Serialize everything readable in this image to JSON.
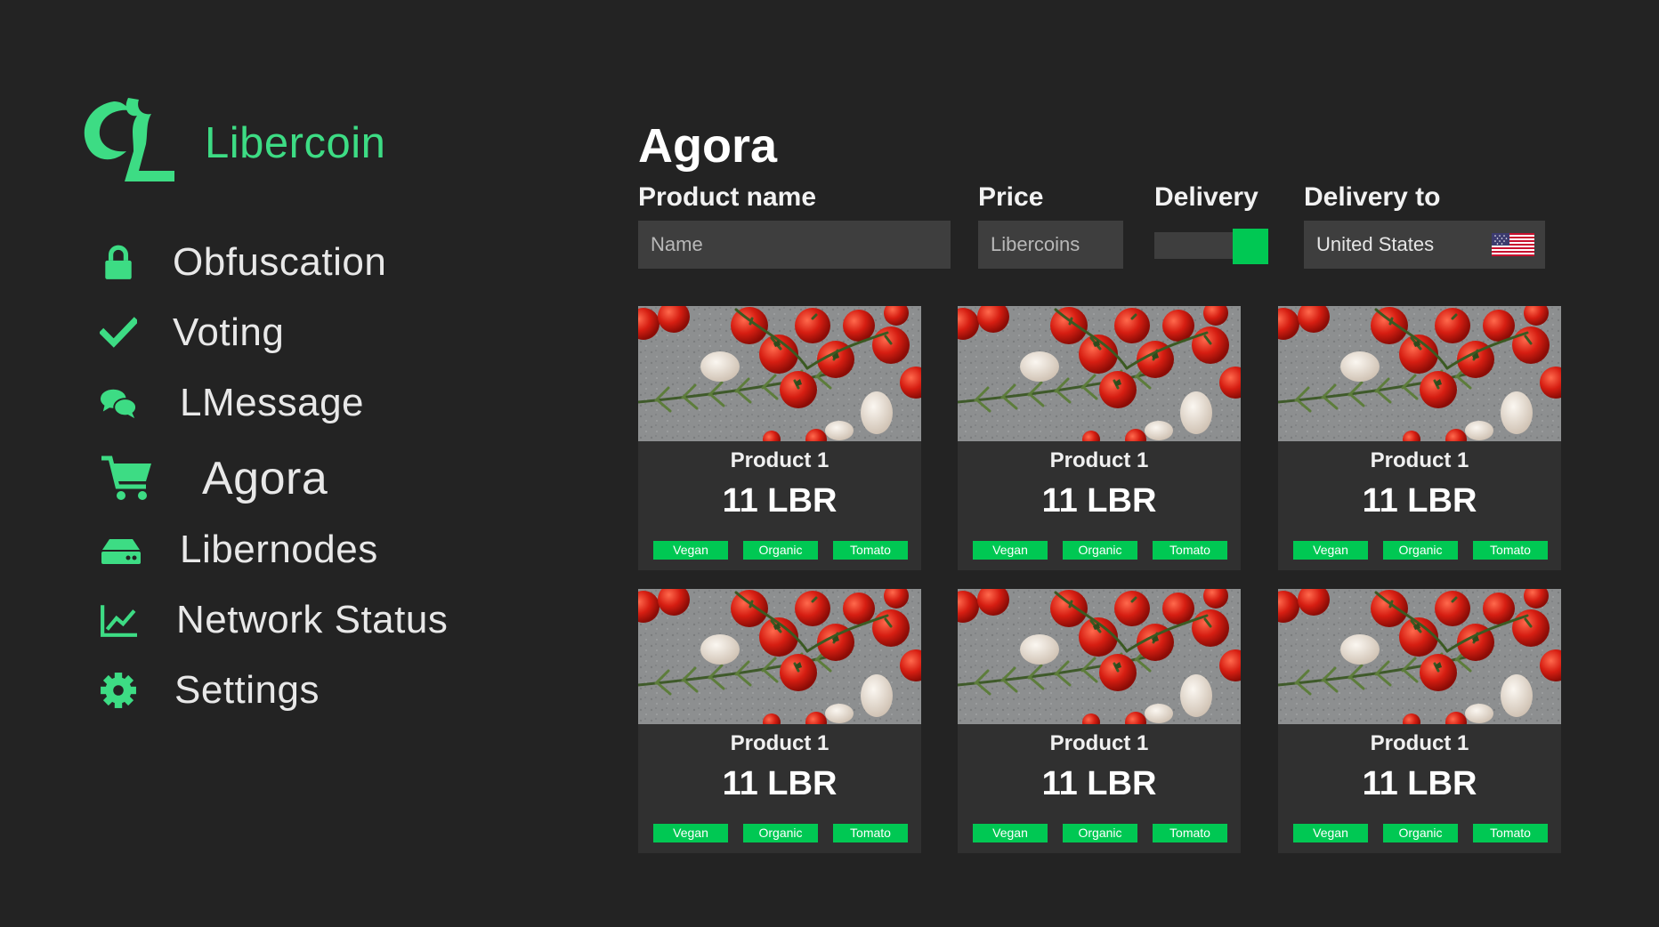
{
  "app": {
    "name": "Libercoin",
    "brand_color": "#3ddc84",
    "accent_color": "#00c853",
    "background": "#232323"
  },
  "sidebar": {
    "items": [
      {
        "label": "Obfuscation",
        "icon": "lock-icon"
      },
      {
        "label": "Voting",
        "icon": "checkmark-icon"
      },
      {
        "label": "LMessage",
        "icon": "chat-bubbles-icon"
      },
      {
        "label": "Agora",
        "icon": "shopping-cart-icon",
        "active": true
      },
      {
        "label": "Libernodes",
        "icon": "server-drive-icon"
      },
      {
        "label": "Network Status",
        "icon": "line-chart-icon"
      },
      {
        "label": "Settings",
        "icon": "gear-icon"
      }
    ]
  },
  "page": {
    "title": "Agora"
  },
  "filters": {
    "product_name": {
      "label": "Product name",
      "placeholder": "Name"
    },
    "price": {
      "label": "Price",
      "placeholder": "Libercoins"
    },
    "delivery": {
      "label": "Delivery",
      "enabled": true
    },
    "delivery_to": {
      "label": "Delivery to",
      "value": "United States",
      "flag": "us-flag-icon"
    }
  },
  "products": [
    {
      "name": "Product 1",
      "price": "11 LBR",
      "tags": [
        "Vegan",
        "Organic",
        "Tomato"
      ]
    },
    {
      "name": "Product 1",
      "price": "11 LBR",
      "tags": [
        "Vegan",
        "Organic",
        "Tomato"
      ]
    },
    {
      "name": "Product 1",
      "price": "11 LBR",
      "tags": [
        "Vegan",
        "Organic",
        "Tomato"
      ]
    },
    {
      "name": "Product 1",
      "price": "11 LBR",
      "tags": [
        "Vegan",
        "Organic",
        "Tomato"
      ]
    },
    {
      "name": "Product 1",
      "price": "11 LBR",
      "tags": [
        "Vegan",
        "Organic",
        "Tomato"
      ]
    },
    {
      "name": "Product 1",
      "price": "11 LBR",
      "tags": [
        "Vegan",
        "Organic",
        "Tomato"
      ]
    }
  ]
}
